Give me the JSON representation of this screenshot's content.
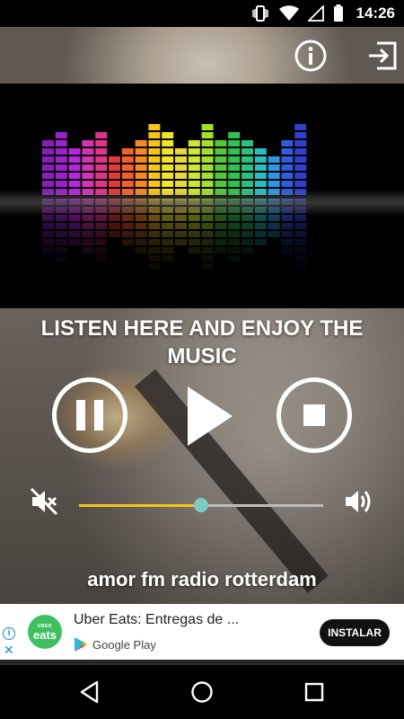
{
  "status_bar": {
    "time": "14:26",
    "icons": [
      "vibrate-icon",
      "wifi-icon",
      "signal-icon",
      "battery-icon"
    ]
  },
  "header": {
    "icons": [
      "info-icon",
      "exit-icon"
    ]
  },
  "player": {
    "headline": "LISTEN HERE AND ENJOY THE MUSIC",
    "station_name": "amor fm radio rotterdam",
    "volume_level": 0.5,
    "colors": {
      "slider_fill": "#f5c518",
      "slider_thumb": "#7ecbc4",
      "slider_track": "#bdbdbd"
    }
  },
  "equalizer": {
    "bar_colors": [
      "#8a1db8",
      "#9b22c8",
      "#b526d6",
      "#d633b4",
      "#e0348a",
      "#e13a3a",
      "#f1612c",
      "#f58a1e",
      "#f7c51a",
      "#f2e22a",
      "#e9d83a",
      "#d2e62d",
      "#a5df2a",
      "#52c83b",
      "#2fc253",
      "#28c17e",
      "#2bbcbc",
      "#2e97e0",
      "#2f5bdc",
      "#3140c8"
    ],
    "bar_levels": [
      7,
      8,
      6,
      7,
      8,
      5,
      6,
      7,
      9,
      8,
      6,
      7,
      9,
      7,
      8,
      7,
      6,
      5,
      7,
      9
    ]
  },
  "ad": {
    "title": "Uber Eats: Entregas de ...",
    "store_label": "Google Play",
    "install_label": "INSTALAR",
    "logo_small": "UBER",
    "logo_big": "eats",
    "info_symbol": "i",
    "close_symbol": "✕",
    "logo_color": "#3fc060"
  },
  "nav_bar": {
    "icons": [
      "back-icon",
      "home-icon",
      "recents-icon"
    ]
  }
}
